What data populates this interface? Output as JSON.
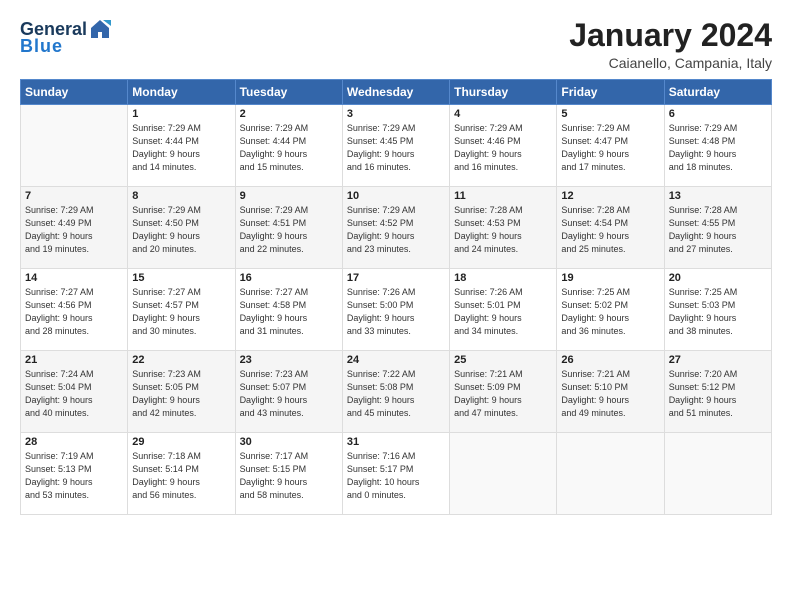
{
  "header": {
    "logo_general": "General",
    "logo_blue": "Blue",
    "month_title": "January 2024",
    "location": "Caianello, Campania, Italy"
  },
  "weekdays": [
    "Sunday",
    "Monday",
    "Tuesday",
    "Wednesday",
    "Thursday",
    "Friday",
    "Saturday"
  ],
  "weeks": [
    [
      {
        "day": "",
        "info": ""
      },
      {
        "day": "1",
        "info": "Sunrise: 7:29 AM\nSunset: 4:44 PM\nDaylight: 9 hours\nand 14 minutes."
      },
      {
        "day": "2",
        "info": "Sunrise: 7:29 AM\nSunset: 4:44 PM\nDaylight: 9 hours\nand 15 minutes."
      },
      {
        "day": "3",
        "info": "Sunrise: 7:29 AM\nSunset: 4:45 PM\nDaylight: 9 hours\nand 16 minutes."
      },
      {
        "day": "4",
        "info": "Sunrise: 7:29 AM\nSunset: 4:46 PM\nDaylight: 9 hours\nand 16 minutes."
      },
      {
        "day": "5",
        "info": "Sunrise: 7:29 AM\nSunset: 4:47 PM\nDaylight: 9 hours\nand 17 minutes."
      },
      {
        "day": "6",
        "info": "Sunrise: 7:29 AM\nSunset: 4:48 PM\nDaylight: 9 hours\nand 18 minutes."
      }
    ],
    [
      {
        "day": "7",
        "info": "Sunrise: 7:29 AM\nSunset: 4:49 PM\nDaylight: 9 hours\nand 19 minutes."
      },
      {
        "day": "8",
        "info": "Sunrise: 7:29 AM\nSunset: 4:50 PM\nDaylight: 9 hours\nand 20 minutes."
      },
      {
        "day": "9",
        "info": "Sunrise: 7:29 AM\nSunset: 4:51 PM\nDaylight: 9 hours\nand 22 minutes."
      },
      {
        "day": "10",
        "info": "Sunrise: 7:29 AM\nSunset: 4:52 PM\nDaylight: 9 hours\nand 23 minutes."
      },
      {
        "day": "11",
        "info": "Sunrise: 7:28 AM\nSunset: 4:53 PM\nDaylight: 9 hours\nand 24 minutes."
      },
      {
        "day": "12",
        "info": "Sunrise: 7:28 AM\nSunset: 4:54 PM\nDaylight: 9 hours\nand 25 minutes."
      },
      {
        "day": "13",
        "info": "Sunrise: 7:28 AM\nSunset: 4:55 PM\nDaylight: 9 hours\nand 27 minutes."
      }
    ],
    [
      {
        "day": "14",
        "info": "Sunrise: 7:27 AM\nSunset: 4:56 PM\nDaylight: 9 hours\nand 28 minutes."
      },
      {
        "day": "15",
        "info": "Sunrise: 7:27 AM\nSunset: 4:57 PM\nDaylight: 9 hours\nand 30 minutes."
      },
      {
        "day": "16",
        "info": "Sunrise: 7:27 AM\nSunset: 4:58 PM\nDaylight: 9 hours\nand 31 minutes."
      },
      {
        "day": "17",
        "info": "Sunrise: 7:26 AM\nSunset: 5:00 PM\nDaylight: 9 hours\nand 33 minutes."
      },
      {
        "day": "18",
        "info": "Sunrise: 7:26 AM\nSunset: 5:01 PM\nDaylight: 9 hours\nand 34 minutes."
      },
      {
        "day": "19",
        "info": "Sunrise: 7:25 AM\nSunset: 5:02 PM\nDaylight: 9 hours\nand 36 minutes."
      },
      {
        "day": "20",
        "info": "Sunrise: 7:25 AM\nSunset: 5:03 PM\nDaylight: 9 hours\nand 38 minutes."
      }
    ],
    [
      {
        "day": "21",
        "info": "Sunrise: 7:24 AM\nSunset: 5:04 PM\nDaylight: 9 hours\nand 40 minutes."
      },
      {
        "day": "22",
        "info": "Sunrise: 7:23 AM\nSunset: 5:05 PM\nDaylight: 9 hours\nand 42 minutes."
      },
      {
        "day": "23",
        "info": "Sunrise: 7:23 AM\nSunset: 5:07 PM\nDaylight: 9 hours\nand 43 minutes."
      },
      {
        "day": "24",
        "info": "Sunrise: 7:22 AM\nSunset: 5:08 PM\nDaylight: 9 hours\nand 45 minutes."
      },
      {
        "day": "25",
        "info": "Sunrise: 7:21 AM\nSunset: 5:09 PM\nDaylight: 9 hours\nand 47 minutes."
      },
      {
        "day": "26",
        "info": "Sunrise: 7:21 AM\nSunset: 5:10 PM\nDaylight: 9 hours\nand 49 minutes."
      },
      {
        "day": "27",
        "info": "Sunrise: 7:20 AM\nSunset: 5:12 PM\nDaylight: 9 hours\nand 51 minutes."
      }
    ],
    [
      {
        "day": "28",
        "info": "Sunrise: 7:19 AM\nSunset: 5:13 PM\nDaylight: 9 hours\nand 53 minutes."
      },
      {
        "day": "29",
        "info": "Sunrise: 7:18 AM\nSunset: 5:14 PM\nDaylight: 9 hours\nand 56 minutes."
      },
      {
        "day": "30",
        "info": "Sunrise: 7:17 AM\nSunset: 5:15 PM\nDaylight: 9 hours\nand 58 minutes."
      },
      {
        "day": "31",
        "info": "Sunrise: 7:16 AM\nSunset: 5:17 PM\nDaylight: 10 hours\nand 0 minutes."
      },
      {
        "day": "",
        "info": ""
      },
      {
        "day": "",
        "info": ""
      },
      {
        "day": "",
        "info": ""
      }
    ]
  ]
}
